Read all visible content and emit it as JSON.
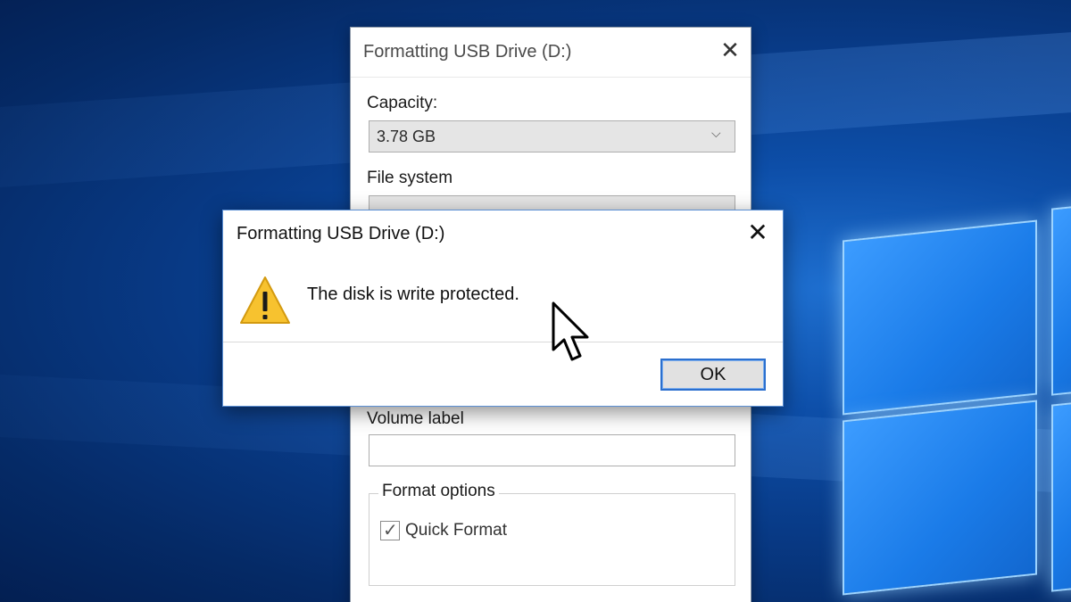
{
  "background": {
    "accent": "#0d4ea8",
    "logo_color": "#3c9cff"
  },
  "format_dialog": {
    "title": "Formatting USB Drive (D:)",
    "close_icon": "close-icon",
    "capacity_label": "Capacity:",
    "capacity_value": "3.78 GB",
    "file_system_label": "File system",
    "volume_label_label": "Volume label",
    "volume_label_value": "",
    "format_options_label": "Format options",
    "quick_format_label": "Quick Format",
    "quick_format_checked": true
  },
  "alert": {
    "title": "Formatting USB Drive (D:)",
    "icon": "warning-icon",
    "message": "The disk is write protected.",
    "ok_label": "OK",
    "accent": "#2b6fce"
  }
}
